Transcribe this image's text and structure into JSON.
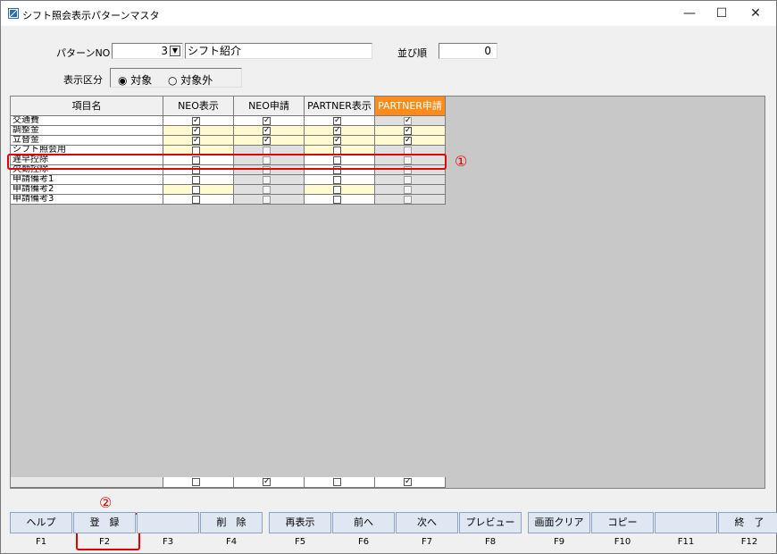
{
  "window": {
    "title": "シフト照会表示パターンマスタ",
    "minimize": "—",
    "maximize": "☐",
    "close": "✕"
  },
  "form": {
    "pattern_label": "パターンNO",
    "pattern_no": "3",
    "pattern_name": "シフト紹介",
    "order_label": "並び順",
    "order_value": "0",
    "display_label": "表示区分",
    "radio_target": "対象",
    "radio_nontarget": "対象外"
  },
  "grid": {
    "headers": [
      "項目名",
      "NEO表示",
      "NEO申請",
      "PARTNER表示",
      "PARTNER申請"
    ],
    "rows": [
      {
        "name": "交通費",
        "checks": [
          true,
          true,
          true,
          true
        ]
      },
      {
        "name": "調整金",
        "checks": [
          true,
          true,
          true,
          true
        ]
      },
      {
        "name": "立替金",
        "checks": [
          true,
          true,
          true,
          true
        ]
      },
      {
        "name": "シフト照会用",
        "checks": [
          false,
          false,
          false,
          false
        ]
      },
      {
        "name": "遅早控除",
        "checks": [
          false,
          false,
          false,
          false
        ]
      },
      {
        "name": "欠勤控除",
        "checks": [
          false,
          false,
          false,
          false
        ]
      },
      {
        "name": "申請備考1",
        "checks": [
          false,
          false,
          false,
          false
        ]
      },
      {
        "name": "申請備考2",
        "checks": [
          false,
          false,
          false,
          false
        ]
      },
      {
        "name": "申請備考3",
        "checks": [
          false,
          false,
          false,
          false
        ]
      }
    ],
    "footer_checks": [
      false,
      true,
      false,
      true
    ]
  },
  "annotations": {
    "one": "①",
    "two": "②"
  },
  "fkeys": [
    {
      "label": "ヘルプ",
      "key": "F1"
    },
    {
      "label": "登　録",
      "key": "F2"
    },
    {
      "label": "",
      "key": "F3"
    },
    {
      "label": "削　除",
      "key": "F4"
    },
    {
      "label": "再表示",
      "key": "F5"
    },
    {
      "label": "前へ",
      "key": "F6"
    },
    {
      "label": "次へ",
      "key": "F7"
    },
    {
      "label": "プレビュー",
      "key": "F8"
    },
    {
      "label": "画面クリア",
      "key": "F9"
    },
    {
      "label": "コピー",
      "key": "F10"
    },
    {
      "label": "",
      "key": "F11"
    },
    {
      "label": "終　了",
      "key": "F12"
    }
  ]
}
